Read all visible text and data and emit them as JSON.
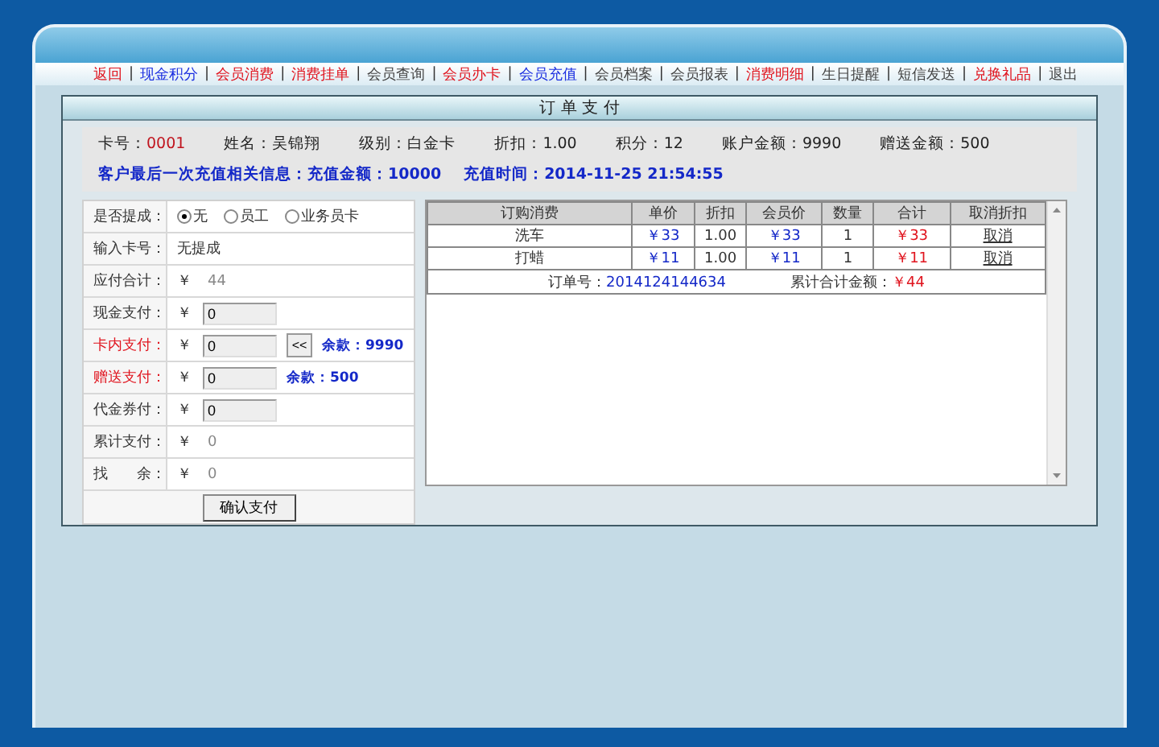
{
  "nav": [
    {
      "label": "返回",
      "color": "#e0141e"
    },
    {
      "separator": "|",
      "label": "现金积分",
      "color": "#1a2ee0"
    },
    {
      "separator": "|",
      "label": "会员消费",
      "color": "#e0141e"
    },
    {
      "separator": "|",
      "label": "消费挂单",
      "color": "#e0141e"
    },
    {
      "separator": "|",
      "label": "会员查询",
      "color": "#444444"
    },
    {
      "separator": "|",
      "label": "会员办卡",
      "color": "#e0141e"
    },
    {
      "separator": "|",
      "label": "会员充值",
      "color": "#1a2ee0"
    },
    {
      "separator": "|",
      "label": "会员档案",
      "color": "#444444"
    },
    {
      "separator": "|",
      "label": "会员报表",
      "color": "#444444"
    },
    {
      "separator": "|",
      "label": "消费明细",
      "color": "#e0141e"
    },
    {
      "separator": "|",
      "label": "生日提醒",
      "color": "#444444"
    },
    {
      "separator": "|",
      "label": "短信发送",
      "color": "#444444"
    },
    {
      "separator": "|",
      "label": "兑换礼品",
      "color": "#e0141e"
    },
    {
      "separator": "|",
      "label": "退出",
      "color": "#444444"
    }
  ],
  "panel": {
    "title": "订 单 支 付"
  },
  "member_info": [
    {
      "label": "卡号：",
      "value": "0001",
      "kind": "highlight"
    },
    {
      "label": "姓名：",
      "value": "吴锦翔",
      "kind": "plain"
    },
    {
      "label": "级别：",
      "value": "白金卡",
      "kind": "plain"
    },
    {
      "label": "折扣：",
      "value": "1.00",
      "kind": "plain"
    },
    {
      "label": "积分：",
      "value": "12",
      "kind": "plain"
    },
    {
      "label": "账户金额：",
      "value": "9990",
      "kind": "plain"
    },
    {
      "label": "赠送金额：",
      "value": "500",
      "kind": "plain"
    }
  ],
  "recharge_info": [
    "客户最后一次充值相关信息：充值金额：10000",
    "充值时间：2014-11-25 21:54:55"
  ],
  "payment_form": [
    {
      "kind": "radio",
      "label": "是否提成：",
      "color": "#333333",
      "options": [
        {
          "label": "无",
          "selected": true
        },
        {
          "label": "员工",
          "selected": false
        },
        {
          "label": "业务员卡",
          "selected": false
        }
      ]
    },
    {
      "kind": "text",
      "label": "输入卡号：",
      "color": "#333333",
      "value": "无提成"
    },
    {
      "kind": "amount",
      "label": "应付合计：",
      "color": "#333333",
      "currency": "￥",
      "value": "44"
    },
    {
      "kind": "input",
      "label": "现金支付：",
      "color": "#333333",
      "currency": "￥",
      "value": "0"
    },
    {
      "kind": "input",
      "label": "卡内支付：",
      "color": "#e0141e",
      "currency": "￥",
      "value": "0",
      "button": "<<",
      "note": "余款：9990"
    },
    {
      "kind": "input",
      "label": "赠送支付：",
      "color": "#e0141e",
      "currency": "￥",
      "value": "0",
      "note": "余款：500"
    },
    {
      "kind": "input",
      "label": "代金券付：",
      "color": "#333333",
      "currency": "￥",
      "value": "0"
    },
    {
      "kind": "amount",
      "label": "累计支付：",
      "color": "#333333",
      "currency": "￥",
      "value": "0"
    },
    {
      "kind": "amount",
      "label": "找　　余：",
      "color": "#333333",
      "currency": "￥",
      "value": "0"
    }
  ],
  "confirm_button": "确认支付",
  "order_table": {
    "columns": [
      "订购消费",
      "单价",
      "折扣",
      "会员价",
      "数量",
      "合计",
      "取消折扣"
    ],
    "rows": [
      [
        "洗车",
        "￥33",
        "1.00",
        "￥33",
        "1",
        "￥33",
        "取消"
      ],
      [
        "打蜡",
        "￥11",
        "1.00",
        "￥11",
        "1",
        "￥11",
        "取消"
      ]
    ],
    "order_no_label": "订单号：",
    "order_no": "2014124144634",
    "total_label": "累计合计金额：",
    "total": "￥44"
  }
}
